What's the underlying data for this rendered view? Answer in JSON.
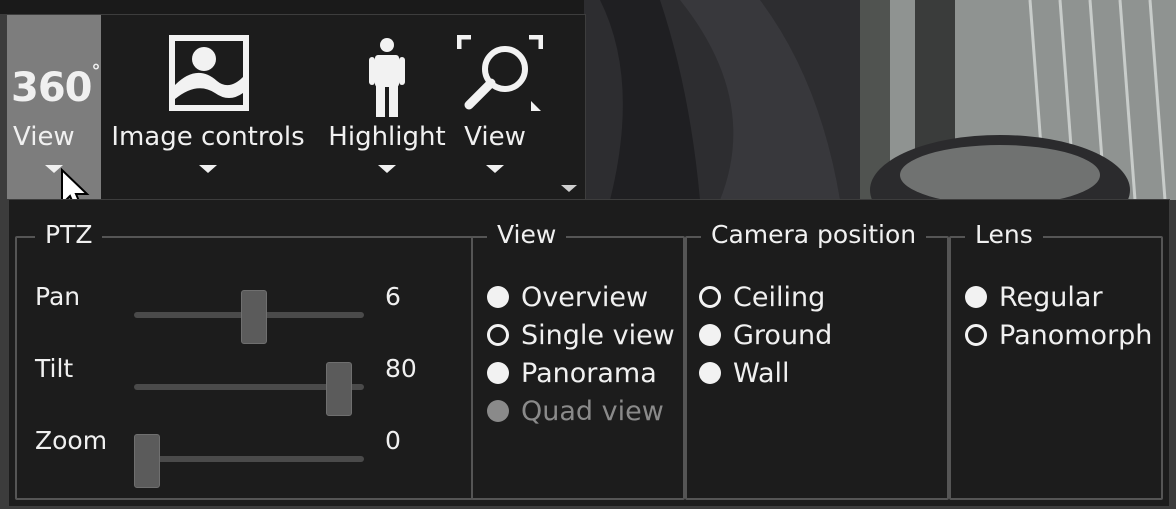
{
  "colors": {
    "panel_bg": "#1c1c1c",
    "active_button": "#7d7d7d",
    "border": "#555555"
  },
  "toolbar": {
    "buttons": [
      {
        "icon_text": "360",
        "icon_sup": "°",
        "label": "View",
        "active": true
      },
      {
        "icon": "landscape-image-icon",
        "label": "Image controls"
      },
      {
        "icon": "person-icon",
        "label": "Highlight"
      },
      {
        "icon": "magnifier-icon",
        "label": "View"
      }
    ]
  },
  "ptz": {
    "title": "PTZ",
    "pan": {
      "label": "Pan",
      "value": "6",
      "level": 0.52
    },
    "tilt": {
      "label": "Tilt",
      "value": "80",
      "level": 0.89
    },
    "zoom": {
      "label": "Zoom",
      "value": "0",
      "level": 0.0
    }
  },
  "view": {
    "title": "View",
    "options": [
      {
        "label": "Overview",
        "state": "filled"
      },
      {
        "label": "Single view",
        "state": "selected"
      },
      {
        "label": "Panorama",
        "state": "filled"
      },
      {
        "label": "Quad view",
        "state": "disabled"
      }
    ]
  },
  "camera_position": {
    "title": "Camera position",
    "options": [
      {
        "label": "Ceiling",
        "state": "selected"
      },
      {
        "label": "Ground",
        "state": "filled"
      },
      {
        "label": "Wall",
        "state": "filled"
      }
    ]
  },
  "lens": {
    "title": "Lens",
    "options": [
      {
        "label": "Regular",
        "state": "filled"
      },
      {
        "label": "Panomorph",
        "state": "selected"
      }
    ]
  }
}
